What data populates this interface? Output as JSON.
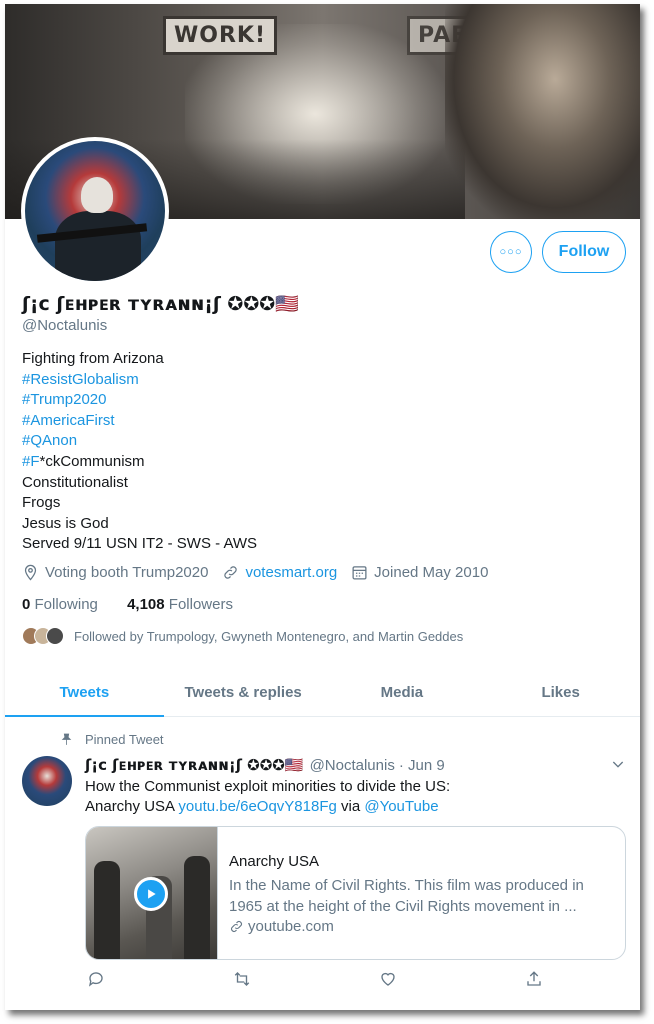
{
  "banner": {
    "sign_left": "WORK!",
    "sign_right": "PAБ"
  },
  "profile": {
    "display_name": "ʃ¡ᴄ ʃᴇʜᴘᴇʀ ᴛʏʀᴀɴɴ¡ʃ ✪✪✪🇺🇸",
    "handle": "@Noctalunis",
    "follow_label": "Follow",
    "bio": {
      "line1": "Fighting from Arizona",
      "tag_resist": "#ResistGlobalism",
      "tag_trump": "#Trump2020",
      "tag_america": "#AmericaFirst",
      "tag_qanon": "#QAnon",
      "tag_f": "#F",
      "f_rest": "*ckCommunism",
      "line7": "Constitutionalist",
      "line8": "Frogs",
      "line9": "Jesus is God",
      "line10": "Served 9/11  USN IT2 - SWS - AWS"
    },
    "location": "Voting booth Trump2020",
    "website": "votesmart.org",
    "joined": "Joined May 2010",
    "following_count": "0",
    "following_label": "Following",
    "followers_count": "4,108",
    "followers_label": "Followers",
    "followed_by": "Followed by Trumpology, Gwyneth Montenegro, and Martin Geddes"
  },
  "tabs": [
    "Tweets",
    "Tweets & replies",
    "Media",
    "Likes"
  ],
  "tweet": {
    "pinned_label": "Pinned Tweet",
    "author_name": "ʃ¡ᴄ ʃᴇʜᴘᴇʀ ᴛʏʀᴀɴɴ¡ʃ ✪✪✪🇺🇸",
    "author_handle": "@Noctalunis",
    "date": "· Jun 9",
    "text_line1": "How the Communist exploit minorities to divide the US:",
    "text_prefix": "Anarchy USA ",
    "link": "youtu.be/6eOqvY818Fg",
    "via": " via ",
    "mention": "@YouTube",
    "card": {
      "title": "Anarchy USA",
      "desc_line1": "In the Name of Civil Rights. This film was produced in",
      "desc_line2": "1965 at the height of the Civil Rights movement in ...",
      "source": "youtube.com"
    }
  },
  "colors": {
    "accent": "#1da1f2",
    "link": "#1b95e0",
    "muted": "#657786"
  }
}
